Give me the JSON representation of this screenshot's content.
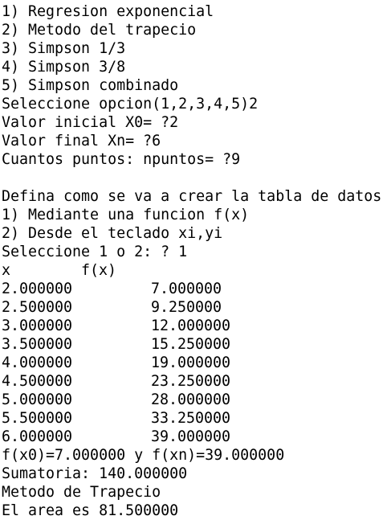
{
  "menu": [
    "1) Regresion exponencial",
    "2) Metodo del trapecio",
    "3) Simpson 1/3",
    "4) Simpson 3/8",
    "5) Simpson combinado"
  ],
  "prompts": {
    "select_option": "Seleccione opcion(1,2,3,4,5)2",
    "initial_value": "Valor inicial X0= ?2",
    "final_value": "Valor final Xn= ?6",
    "points": "Cuantos puntos: npuntos= ?9"
  },
  "table_def": {
    "title": "Defina como se va a crear la tabla de datos",
    "option1": "1) Mediante una funcion f(x)",
    "option2": "2) Desde el teclado xi,yi",
    "choice": "Seleccione 1 o 2: ? 1"
  },
  "table": {
    "header_x": "x",
    "header_fx": "f(x)",
    "rows": [
      {
        "x": "2.000000",
        "fx": "7.000000"
      },
      {
        "x": "2.500000",
        "fx": "9.250000"
      },
      {
        "x": "3.000000",
        "fx": "12.000000"
      },
      {
        "x": "3.500000",
        "fx": "15.250000"
      },
      {
        "x": "4.000000",
        "fx": "19.000000"
      },
      {
        "x": "4.500000",
        "fx": "23.250000"
      },
      {
        "x": "5.000000",
        "fx": "28.000000"
      },
      {
        "x": "5.500000",
        "fx": "33.250000"
      },
      {
        "x": "6.000000",
        "fx": "39.000000"
      }
    ]
  },
  "results": {
    "endpoints": "f(x0)=7.000000 y f(xn)=39.000000",
    "sum": "Sumatoria: 140.000000",
    "method": "Metodo de Trapecio",
    "area": "El area es 81.500000"
  }
}
